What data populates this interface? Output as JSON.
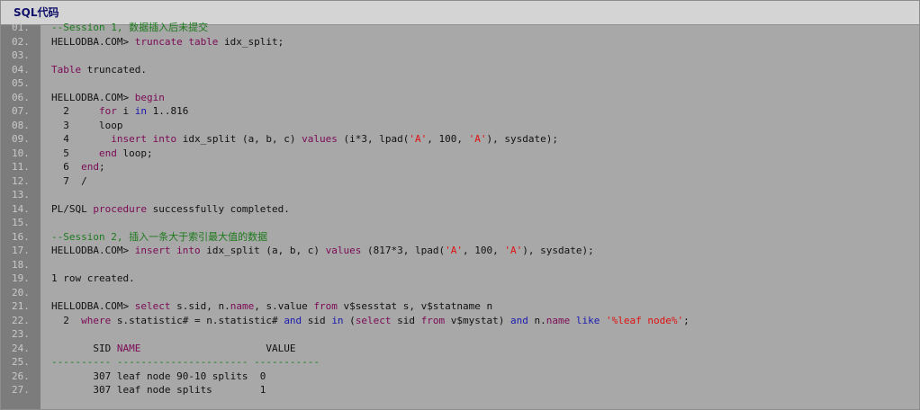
{
  "title": "SQL代码",
  "colors": {
    "keyword": "#7b0a55",
    "keyword_alt": "#1a1ab0",
    "string": "#e01010",
    "comment": "#1d7a1d",
    "text": "#111111",
    "line_number": "#c9c9c9",
    "code_background": "#a8a8a8",
    "gutter_background": "#7c7c7c",
    "title_background": "#d4d4d4",
    "title_text": "#10106a"
  },
  "lines": [
    {
      "num": "01.",
      "tokens": [
        {
          "t": "--Session 1, 数据插入后未提交",
          "c": "cmt"
        }
      ]
    },
    {
      "num": "02.",
      "tokens": [
        {
          "t": "HELLODBA.COM> ",
          "c": "plain"
        },
        {
          "t": "truncate table",
          "c": "kw"
        },
        {
          "t": " idx_split;",
          "c": "plain"
        }
      ]
    },
    {
      "num": "03.",
      "tokens": []
    },
    {
      "num": "04.",
      "tokens": [
        {
          "t": "Table",
          "c": "kw"
        },
        {
          "t": " truncated.",
          "c": "plain"
        }
      ]
    },
    {
      "num": "05.",
      "tokens": []
    },
    {
      "num": "06.",
      "tokens": [
        {
          "t": "HELLODBA.COM> ",
          "c": "plain"
        },
        {
          "t": "begin",
          "c": "kw"
        }
      ]
    },
    {
      "num": "07.",
      "tokens": [
        {
          "t": "  2     ",
          "c": "plain"
        },
        {
          "t": "for",
          "c": "kw"
        },
        {
          "t": " i ",
          "c": "plain"
        },
        {
          "t": "in",
          "c": "kw2"
        },
        {
          "t": " 1..816",
          "c": "plain"
        }
      ]
    },
    {
      "num": "08.",
      "tokens": [
        {
          "t": "  3     loop",
          "c": "plain"
        }
      ]
    },
    {
      "num": "09.",
      "tokens": [
        {
          "t": "  4       ",
          "c": "plain"
        },
        {
          "t": "insert into",
          "c": "kw"
        },
        {
          "t": " idx_split (a, b, c) ",
          "c": "plain"
        },
        {
          "t": "values",
          "c": "kw"
        },
        {
          "t": " (i*3, lpad(",
          "c": "plain"
        },
        {
          "t": "'A'",
          "c": "str"
        },
        {
          "t": ", 100, ",
          "c": "plain"
        },
        {
          "t": "'A'",
          "c": "str"
        },
        {
          "t": "), sysdate);",
          "c": "plain"
        }
      ]
    },
    {
      "num": "10.",
      "tokens": [
        {
          "t": "  5     ",
          "c": "plain"
        },
        {
          "t": "end",
          "c": "kw"
        },
        {
          "t": " loop;",
          "c": "plain"
        }
      ]
    },
    {
      "num": "11.",
      "tokens": [
        {
          "t": "  6  ",
          "c": "plain"
        },
        {
          "t": "end",
          "c": "kw"
        },
        {
          "t": ";",
          "c": "plain"
        }
      ]
    },
    {
      "num": "12.",
      "tokens": [
        {
          "t": "  7  /",
          "c": "plain"
        }
      ]
    },
    {
      "num": "13.",
      "tokens": []
    },
    {
      "num": "14.",
      "tokens": [
        {
          "t": "PL/SQL ",
          "c": "plain"
        },
        {
          "t": "procedure",
          "c": "kw"
        },
        {
          "t": " successfully completed.",
          "c": "plain"
        }
      ]
    },
    {
      "num": "15.",
      "tokens": []
    },
    {
      "num": "16.",
      "tokens": [
        {
          "t": "--Session 2, 插入一条大于索引最大值的数据",
          "c": "cmt"
        }
      ]
    },
    {
      "num": "17.",
      "tokens": [
        {
          "t": "HELLODBA.COM> ",
          "c": "plain"
        },
        {
          "t": "insert into",
          "c": "kw"
        },
        {
          "t": " idx_split (a, b, c) ",
          "c": "plain"
        },
        {
          "t": "values",
          "c": "kw"
        },
        {
          "t": " (817*3, lpad(",
          "c": "plain"
        },
        {
          "t": "'A'",
          "c": "str"
        },
        {
          "t": ", 100, ",
          "c": "plain"
        },
        {
          "t": "'A'",
          "c": "str"
        },
        {
          "t": "), sysdate);",
          "c": "plain"
        }
      ]
    },
    {
      "num": "18.",
      "tokens": []
    },
    {
      "num": "19.",
      "tokens": [
        {
          "t": "1 row created.",
          "c": "plain"
        }
      ]
    },
    {
      "num": "20.",
      "tokens": []
    },
    {
      "num": "21.",
      "tokens": [
        {
          "t": "HELLODBA.COM> ",
          "c": "plain"
        },
        {
          "t": "select",
          "c": "kw"
        },
        {
          "t": " s.sid, n.",
          "c": "plain"
        },
        {
          "t": "name",
          "c": "kw"
        },
        {
          "t": ", s.value ",
          "c": "plain"
        },
        {
          "t": "from",
          "c": "kw"
        },
        {
          "t": " v$sesstat s, v$statname n",
          "c": "plain"
        }
      ]
    },
    {
      "num": "22.",
      "tokens": [
        {
          "t": "  2  ",
          "c": "plain"
        },
        {
          "t": "where",
          "c": "kw"
        },
        {
          "t": " s.statistic# = n.statistic# ",
          "c": "plain"
        },
        {
          "t": "and",
          "c": "kw2"
        },
        {
          "t": " sid ",
          "c": "plain"
        },
        {
          "t": "in",
          "c": "kw2"
        },
        {
          "t": " (",
          "c": "plain"
        },
        {
          "t": "select",
          "c": "kw"
        },
        {
          "t": " sid ",
          "c": "plain"
        },
        {
          "t": "from",
          "c": "kw"
        },
        {
          "t": " v$mystat) ",
          "c": "plain"
        },
        {
          "t": "and",
          "c": "kw2"
        },
        {
          "t": " n.",
          "c": "plain"
        },
        {
          "t": "name",
          "c": "kw"
        },
        {
          "t": " ",
          "c": "plain"
        },
        {
          "t": "like",
          "c": "kw2"
        },
        {
          "t": " ",
          "c": "plain"
        },
        {
          "t": "'%leaf node%'",
          "c": "str"
        },
        {
          "t": ";",
          "c": "plain"
        }
      ]
    },
    {
      "num": "23.",
      "tokens": []
    },
    {
      "num": "24.",
      "tokens": [
        {
          "t": "       SID ",
          "c": "plain"
        },
        {
          "t": "NAME",
          "c": "kw"
        },
        {
          "t": "                     VALUE",
          "c": "plain"
        }
      ]
    },
    {
      "num": "25.",
      "tokens": [
        {
          "t": "---------- ---------------------- -----------",
          "c": "cmt"
        }
      ]
    },
    {
      "num": "26.",
      "tokens": [
        {
          "t": "       307 leaf node 90-10 splits  0",
          "c": "plain"
        }
      ]
    },
    {
      "num": "27.",
      "tokens": [
        {
          "t": "       307 leaf node splits        1",
          "c": "plain"
        }
      ]
    }
  ]
}
